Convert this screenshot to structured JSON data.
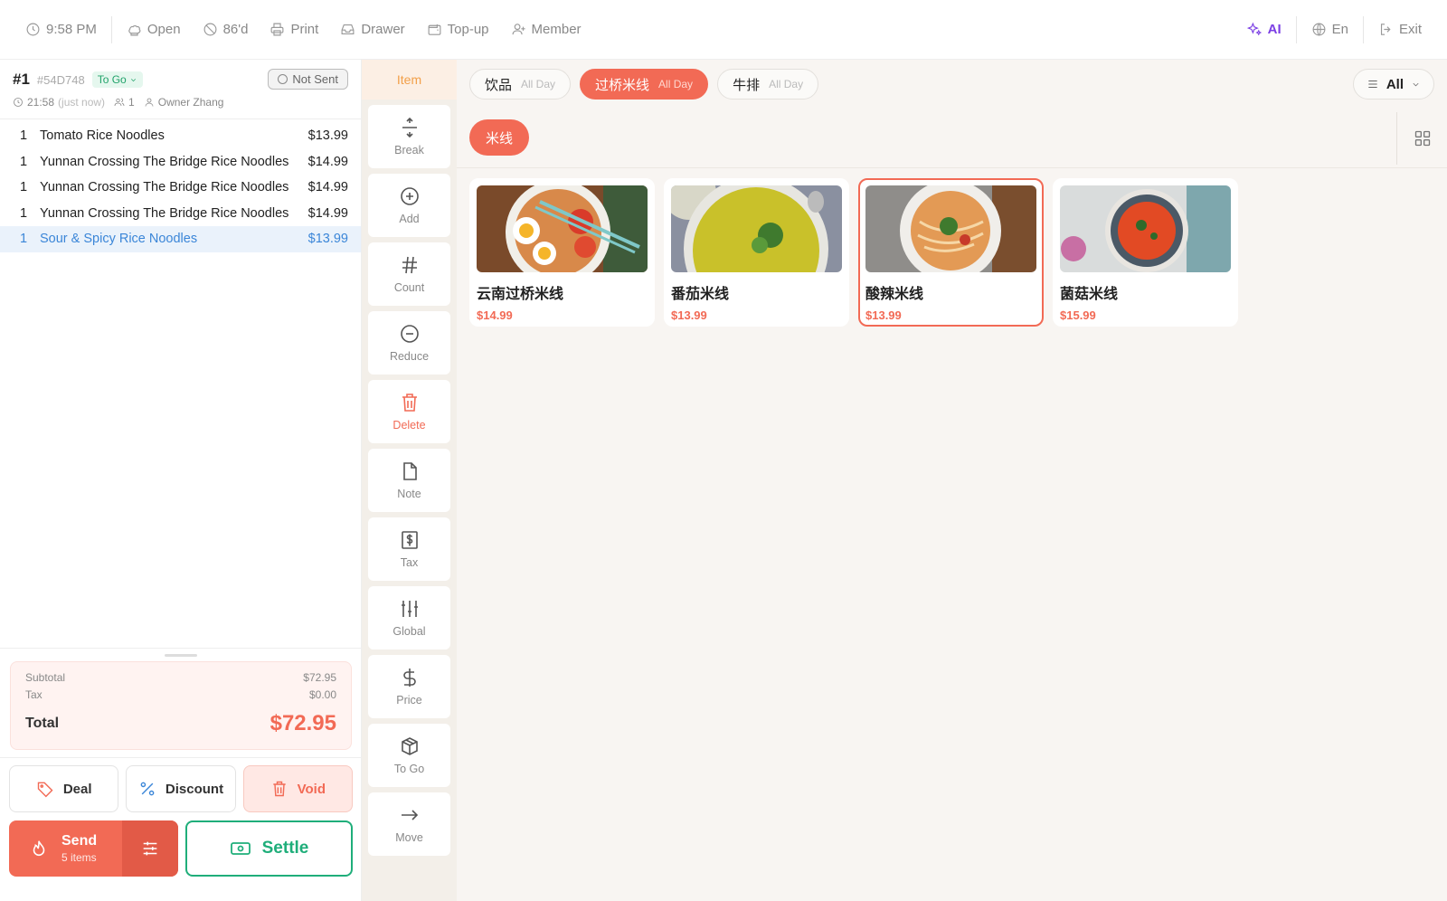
{
  "topbar": {
    "time": "9:58 PM",
    "open": "Open",
    "eightysix": "86'd",
    "print": "Print",
    "drawer": "Drawer",
    "topup": "Top-up",
    "member": "Member",
    "ai": "AI",
    "lang": "En",
    "exit": "Exit"
  },
  "order": {
    "number": "#1",
    "code": "#54D748",
    "type": "To Go",
    "status": "Not Sent",
    "time": "21:58",
    "time_rel": "(just now)",
    "guests": "1",
    "server": "Owner Zhang"
  },
  "items": [
    {
      "qty": "1",
      "name": "Tomato Rice Noodles",
      "price": "$13.99"
    },
    {
      "qty": "1",
      "name": "Yunnan Crossing The Bridge Rice Noodles",
      "price": "$14.99"
    },
    {
      "qty": "1",
      "name": "Yunnan Crossing The Bridge Rice Noodles",
      "price": "$14.99"
    },
    {
      "qty": "1",
      "name": "Yunnan Crossing The Bridge Rice Noodles",
      "price": "$14.99"
    },
    {
      "qty": "1",
      "name": "Sour & Spicy Rice Noodles",
      "price": "$13.99"
    }
  ],
  "totals": {
    "subtotal_label": "Subtotal",
    "subtotal": "$72.95",
    "tax_label": "Tax",
    "tax": "$0.00",
    "total_label": "Total",
    "total": "$72.95"
  },
  "actions": {
    "deal": "Deal",
    "discount": "Discount",
    "void": "Void",
    "send": "Send",
    "send_sub": "5 items",
    "settle": "Settle"
  },
  "tools": {
    "header": "Item",
    "buttons": [
      "Break",
      "Add",
      "Count",
      "Reduce",
      "Delete",
      "Note",
      "Tax",
      "Global",
      "Price",
      "To Go",
      "Move"
    ]
  },
  "categories": [
    {
      "name": "饮品",
      "sub": "All Day"
    },
    {
      "name": "过桥米线",
      "sub": "All Day"
    },
    {
      "name": "牛排",
      "sub": "All Day"
    }
  ],
  "filter": "All",
  "subcategory": "米线",
  "products": [
    {
      "name": "云南过桥米线",
      "price": "$14.99"
    },
    {
      "name": "番茄米线",
      "price": "$13.99"
    },
    {
      "name": "酸辣米线",
      "price": "$13.99"
    },
    {
      "name": "菌菇米线",
      "price": "$15.99"
    }
  ],
  "colors": {
    "accent": "#f26a55",
    "success": "#1fae7a",
    "ai": "#7b3fe4",
    "tool_header": "#f29f48"
  }
}
